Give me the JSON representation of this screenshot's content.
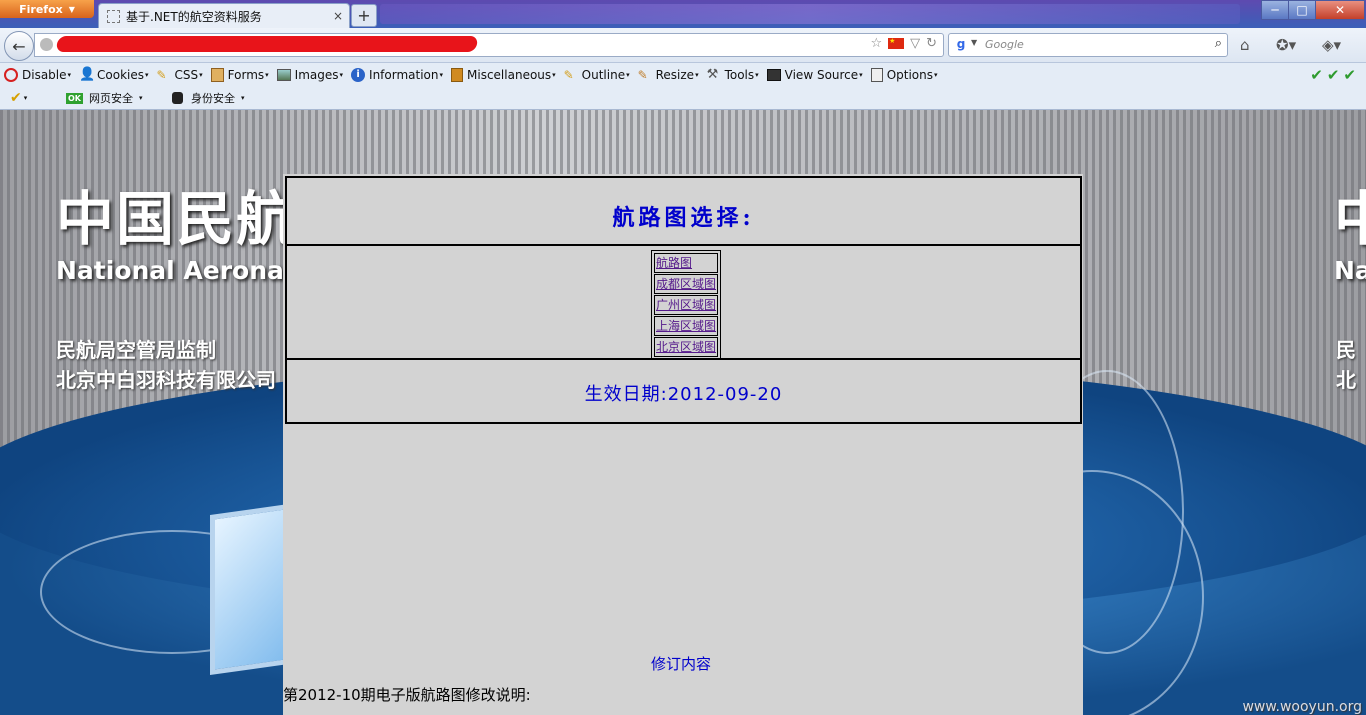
{
  "browser": {
    "menu_button": "Firefox",
    "tab_title": "基于.NET的航空资料服务",
    "new_tab_label": "+",
    "window_controls": {
      "minimize": "─",
      "maximize": "□",
      "close": "✕"
    },
    "search_placeholder": "Google"
  },
  "devtoolbar": {
    "items": [
      {
        "label": "Disable",
        "icon": "no-entry-icon",
        "color": "#d62020"
      },
      {
        "label": "Cookies",
        "icon": "user-icon",
        "color": "#333333"
      },
      {
        "label": "CSS",
        "icon": "pencil-icon",
        "color": "#d4a020"
      },
      {
        "label": "Forms",
        "icon": "clipboard-icon",
        "color": "#c08030"
      },
      {
        "label": "Images",
        "icon": "image-icon",
        "color": "#557755"
      },
      {
        "label": "Information",
        "icon": "info-icon",
        "color": "#2a63c8"
      },
      {
        "label": "Miscellaneous",
        "icon": "book-icon",
        "color": "#d08a20"
      },
      {
        "label": "Outline",
        "icon": "pencil-icon",
        "color": "#d4a020"
      },
      {
        "label": "Resize",
        "icon": "ruler-icon",
        "color": "#c08030"
      },
      {
        "label": "Tools",
        "icon": "tools-icon",
        "color": "#555555"
      },
      {
        "label": "View Source",
        "icon": "monitor-icon",
        "color": "#333333"
      },
      {
        "label": "Options",
        "icon": "options-icon",
        "color": "#555555"
      }
    ]
  },
  "secbar": {
    "web_safety": "网页安全",
    "ok_badge": "OK",
    "identity_safety": "身份安全"
  },
  "site": {
    "logo_cn": "中国民航",
    "logo_en": "National Aeronau",
    "supervision": "民航局空管局监制",
    "company": "北京中白羽科技有限公司",
    "logo_cn_right": "中",
    "logo_en_right": "Na",
    "supervision_right": "民",
    "company_right": "北"
  },
  "panel": {
    "title": "航路图选择:",
    "links": [
      "航路图",
      "成都区域图",
      "广州区域图",
      "上海区域图",
      "北京区域图"
    ],
    "effective_date": "生效日期:2012-09-20",
    "revision_link": "修订内容",
    "note": "第2012-10期电子版航路图修改说明:"
  },
  "watermark": "www.wooyun.org"
}
